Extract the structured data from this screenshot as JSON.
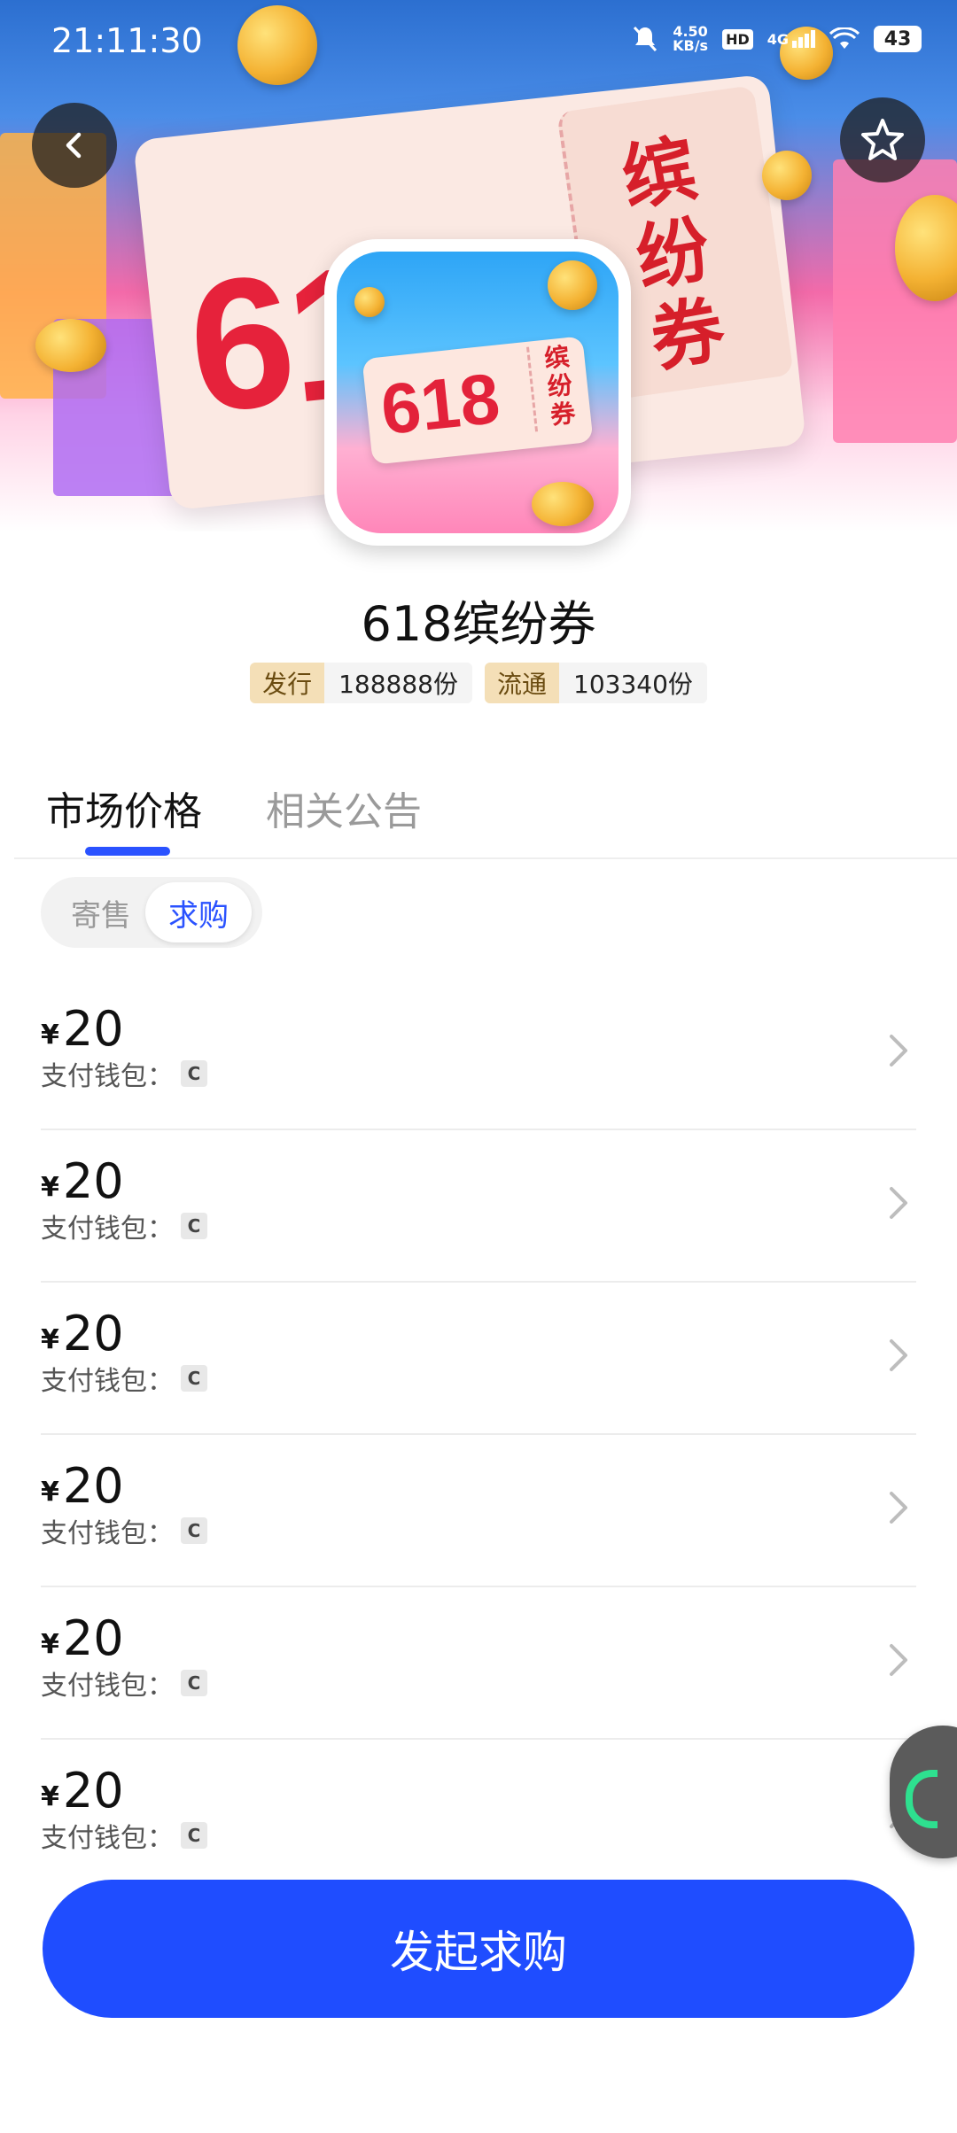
{
  "status_bar": {
    "time": "21:11:30",
    "speed_value": "4.50",
    "speed_unit": "KB/s",
    "hd": "HD",
    "network": "4G",
    "battery": "43"
  },
  "hero": {
    "banner_number": "618",
    "banner_text": "缤纷券"
  },
  "app_icon": {
    "number": "618",
    "text": "缤纷券"
  },
  "product": {
    "title": "618缤纷券",
    "badges": [
      {
        "key": "发行",
        "value": "188888份"
      },
      {
        "key": "流通",
        "value": "103340份"
      }
    ]
  },
  "tabs": [
    {
      "label": "市场价格",
      "active": true
    },
    {
      "label": "相关公告",
      "active": false
    }
  ],
  "segment": {
    "options": [
      "寄售",
      "求购"
    ],
    "selected": "求购"
  },
  "listings": [
    {
      "currency": "¥",
      "price": "20",
      "wallet_label": "支付钱包：",
      "wallet_chip": "C"
    },
    {
      "currency": "¥",
      "price": "20",
      "wallet_label": "支付钱包：",
      "wallet_chip": "C"
    },
    {
      "currency": "¥",
      "price": "20",
      "wallet_label": "支付钱包：",
      "wallet_chip": "C"
    },
    {
      "currency": "¥",
      "price": "20",
      "wallet_label": "支付钱包：",
      "wallet_chip": "C"
    },
    {
      "currency": "¥",
      "price": "20",
      "wallet_label": "支付钱包：",
      "wallet_chip": "C"
    },
    {
      "currency": "¥",
      "price": "20",
      "wallet_label": "支付钱包：",
      "wallet_chip": "C"
    }
  ],
  "cta": {
    "label": "发起求购"
  },
  "colors": {
    "accent": "#1f4dff",
    "badge_key_bg": "#f4dfb7"
  }
}
